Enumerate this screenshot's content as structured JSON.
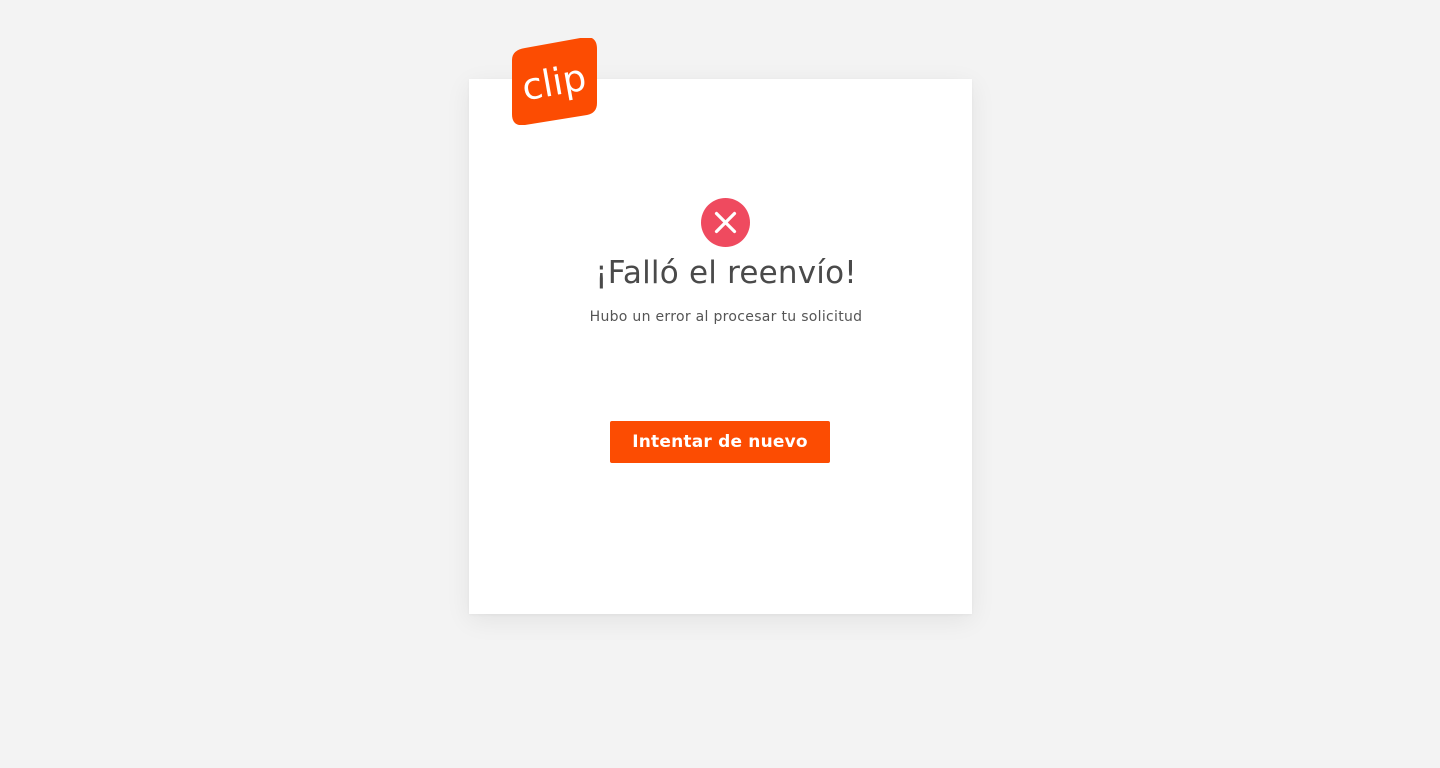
{
  "brand": {
    "logo_text": "clip",
    "accent_color": "#fc4c02",
    "logo_icon": "clip-logo"
  },
  "status": {
    "icon": "error-x-circle-icon",
    "icon_color": "#ef4a5f",
    "title": "¡Falló el reenvío!",
    "message": "Hubo un error al procesar tu solicitud"
  },
  "actions": {
    "retry_label": "Intentar de nuevo"
  }
}
